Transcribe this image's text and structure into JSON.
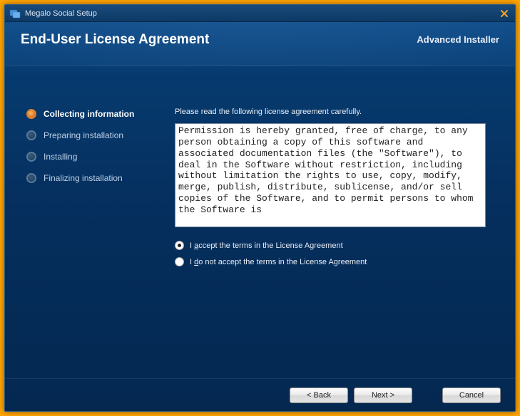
{
  "titlebar": {
    "title": "Megalo Social Setup"
  },
  "header": {
    "heading": "End-User License Agreement",
    "brand": "Advanced Installer"
  },
  "sidebar": {
    "steps": [
      {
        "label": "Collecting information",
        "active": true
      },
      {
        "label": "Preparing installation",
        "active": false
      },
      {
        "label": "Installing",
        "active": false
      },
      {
        "label": "Finalizing installation",
        "active": false
      }
    ]
  },
  "main": {
    "instruction": "Please read the following license agreement carefully.",
    "license_text": "Permission is hereby granted, free of charge, to any person obtaining a copy of this software and associated documentation files (the \"Software\"), to deal in the Software without restriction, including without limitation the rights to use, copy, modify, merge, publish, distribute, sublicense, and/or sell copies of the Software, and to permit persons to whom the Software is",
    "radio_accept_pre": "I ",
    "radio_accept_u": "a",
    "radio_accept_post": "ccept the terms in the License Agreement",
    "radio_reject_pre": "I ",
    "radio_reject_u": "d",
    "radio_reject_post": "o not accept the terms in the License Agreement",
    "accept_selected": true
  },
  "footer": {
    "back": "< Back",
    "next": "Next >",
    "cancel": "Cancel"
  }
}
